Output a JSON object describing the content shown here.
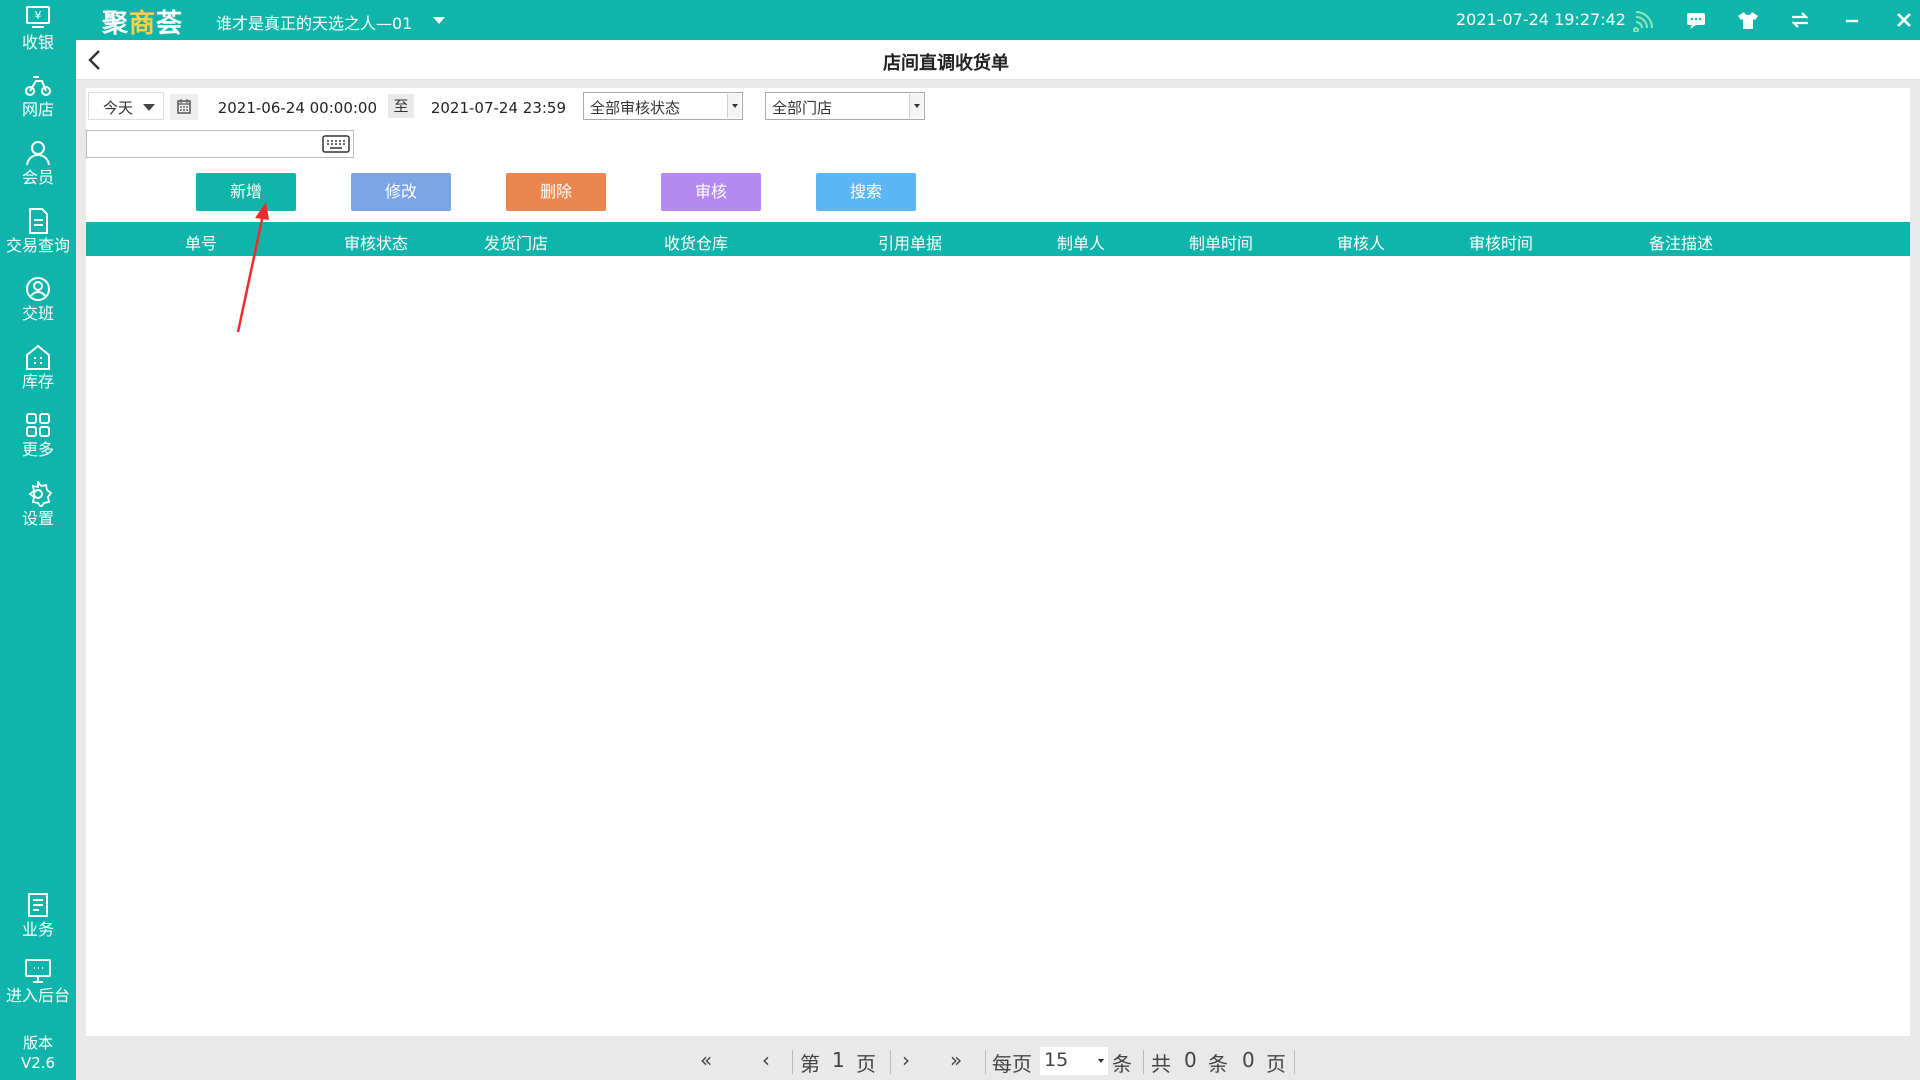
{
  "app": {
    "logo_main": "聚",
    "logo_accent": "商",
    "logo_tail": "荟",
    "shop_name": "谁才是真正的天选之人—01",
    "datetime": "2021-07-24 19:27:42",
    "accent_color": "#0fb5aa"
  },
  "sidebar": {
    "items": [
      {
        "label": "收银",
        "icon": "cashier-icon"
      },
      {
        "label": "网店",
        "icon": "online-shop-icon"
      },
      {
        "label": "会员",
        "icon": "member-icon"
      },
      {
        "label": "交易查询",
        "icon": "transaction-query-icon"
      },
      {
        "label": "交班",
        "icon": "shift-handover-icon"
      },
      {
        "label": "库存",
        "icon": "inventory-icon"
      },
      {
        "label": "更多",
        "icon": "more-icon"
      },
      {
        "label": "设置",
        "icon": "settings-icon"
      },
      {
        "label": "业务",
        "icon": "business-icon"
      },
      {
        "label": "进入后台",
        "icon": "backend-icon"
      }
    ],
    "version_label": "版本",
    "version_value": "V2.6"
  },
  "page": {
    "title": "店间直调收货单"
  },
  "filters": {
    "quick_range": "今天",
    "date_from": "2021-06-24 00:00:00",
    "to_label": "至",
    "date_to": "2021-07-24 23:59",
    "audit_status": "全部审核状态",
    "store": "全部门店",
    "search_value": ""
  },
  "actions": {
    "add": "新增",
    "edit": "修改",
    "delete": "删除",
    "audit": "审核",
    "search": "搜索",
    "colors": {
      "add": "#12b3a8",
      "edit": "#7aa5e6",
      "delete": "#ec8650",
      "audit": "#b48af0",
      "search": "#5cb6f4"
    }
  },
  "table": {
    "columns": [
      "单号",
      "审核状态",
      "发货门店",
      "收货仓库",
      "引用单据",
      "制单人",
      "制单时间",
      "审核人",
      "审核时间",
      "备注描述"
    ],
    "rows": []
  },
  "pagination": {
    "page_prefix": "第",
    "page_number": "1",
    "page_suffix": "页",
    "per_page_label": "每页",
    "per_page_value": "15",
    "per_page_unit": "条",
    "total_prefix": "共",
    "total_records": "0",
    "total_records_unit": "条",
    "total_pages": "0",
    "total_pages_unit": "页"
  }
}
